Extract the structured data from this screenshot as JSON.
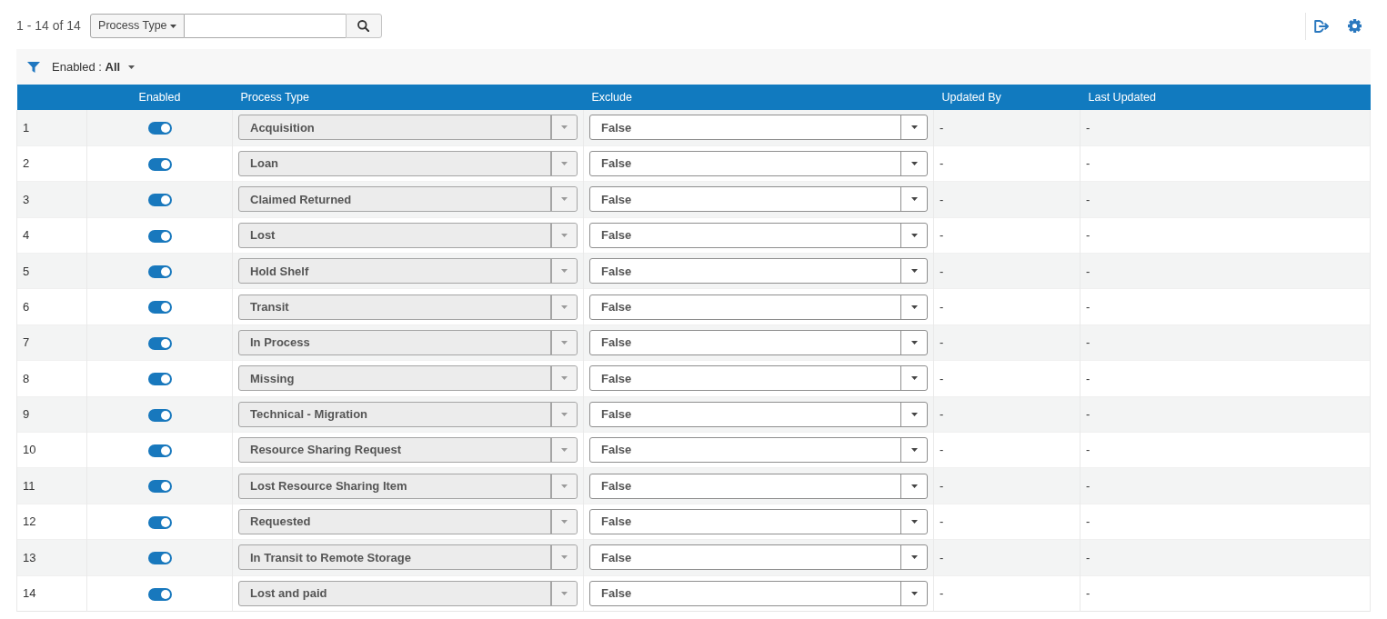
{
  "toolbar": {
    "result_count": "1 - 14 of 14",
    "search_scope": "Process Type"
  },
  "filter": {
    "text": "Enabled : **All**"
  },
  "table": {
    "columns": [
      "Enabled",
      "Process Type",
      "Exclude",
      "Updated By",
      "Last Updated"
    ],
    "rows": [
      {
        "number": "1",
        "enabled": true,
        "process_type": {
          "value": "Acquisition",
          "disabled": true
        },
        "exclude": {
          "value": "False",
          "disabled": false
        },
        "updated_by": "-",
        "last_updated": "-"
      },
      {
        "number": "2",
        "enabled": true,
        "process_type": {
          "value": "Loan",
          "disabled": true
        },
        "exclude": {
          "value": "False",
          "disabled": false
        },
        "updated_by": "-",
        "last_updated": "-"
      },
      {
        "number": "3",
        "enabled": true,
        "process_type": {
          "value": "Claimed Returned",
          "disabled": true
        },
        "exclude": {
          "value": "False",
          "disabled": false
        },
        "updated_by": "-",
        "last_updated": "-"
      },
      {
        "number": "4",
        "enabled": true,
        "process_type": {
          "value": "Lost",
          "disabled": true
        },
        "exclude": {
          "value": "False",
          "disabled": false
        },
        "updated_by": "-",
        "last_updated": "-"
      },
      {
        "number": "5",
        "enabled": true,
        "process_type": {
          "value": "Hold Shelf",
          "disabled": true
        },
        "exclude": {
          "value": "False",
          "disabled": false
        },
        "updated_by": "-",
        "last_updated": "-"
      },
      {
        "number": "6",
        "enabled": true,
        "process_type": {
          "value": "Transit",
          "disabled": true
        },
        "exclude": {
          "value": "False",
          "disabled": false
        },
        "updated_by": "-",
        "last_updated": "-"
      },
      {
        "number": "7",
        "enabled": true,
        "process_type": {
          "value": "In Process",
          "disabled": true
        },
        "exclude": {
          "value": "False",
          "disabled": false
        },
        "updated_by": "-",
        "last_updated": "-"
      },
      {
        "number": "8",
        "enabled": true,
        "process_type": {
          "value": "Missing",
          "disabled": true
        },
        "exclude": {
          "value": "False",
          "disabled": false
        },
        "updated_by": "-",
        "last_updated": "-"
      },
      {
        "number": "9",
        "enabled": true,
        "process_type": {
          "value": "Technical - Migration",
          "disabled": true
        },
        "exclude": {
          "value": "False",
          "disabled": false
        },
        "updated_by": "-",
        "last_updated": "-"
      },
      {
        "number": "10",
        "enabled": true,
        "process_type": {
          "value": "Resource Sharing Request",
          "disabled": true
        },
        "exclude": {
          "value": "False",
          "disabled": false
        },
        "updated_by": "-",
        "last_updated": "-"
      },
      {
        "number": "11",
        "enabled": true,
        "process_type": {
          "value": "Lost Resource Sharing Item",
          "disabled": true
        },
        "exclude": {
          "value": "False",
          "disabled": false
        },
        "updated_by": "-",
        "last_updated": "-"
      },
      {
        "number": "12",
        "enabled": true,
        "process_type": {
          "value": "Requested",
          "disabled": true
        },
        "exclude": {
          "value": "False",
          "disabled": false
        },
        "updated_by": "-",
        "last_updated": "-"
      },
      {
        "number": "13",
        "enabled": true,
        "process_type": {
          "value": "In Transit to Remote Storage",
          "disabled": true
        },
        "exclude": {
          "value": "False",
          "disabled": false
        },
        "updated_by": "-",
        "last_updated": "-"
      },
      {
        "number": "14",
        "enabled": true,
        "process_type": {
          "value": "Lost and paid",
          "disabled": true
        },
        "exclude": {
          "value": "False",
          "disabled": false
        },
        "updated_by": "-",
        "last_updated": "-"
      }
    ]
  }
}
